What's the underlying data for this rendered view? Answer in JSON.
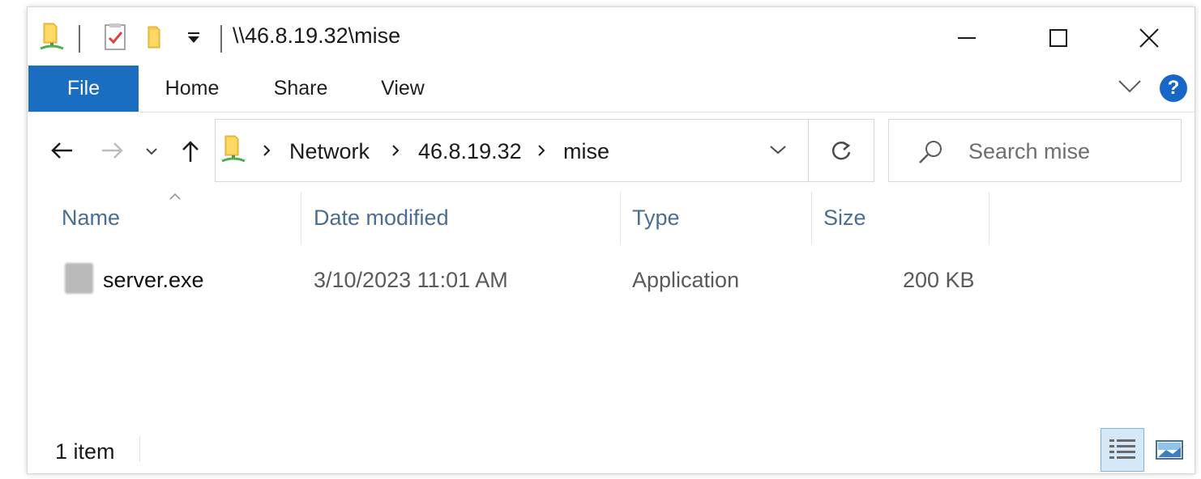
{
  "window": {
    "title": "\\\\46.8.19.32\\mise"
  },
  "ribbon": {
    "tabs": [
      {
        "label": "File"
      },
      {
        "label": "Home"
      },
      {
        "label": "Share"
      },
      {
        "label": "View"
      }
    ],
    "help_label": "?"
  },
  "address": {
    "crumbs": [
      {
        "label": "Network"
      },
      {
        "label": "46.8.19.32"
      },
      {
        "label": "mise"
      }
    ]
  },
  "search": {
    "placeholder": "Search mise"
  },
  "columns": [
    {
      "label": "Name"
    },
    {
      "label": "Date modified"
    },
    {
      "label": "Type"
    },
    {
      "label": "Size"
    }
  ],
  "files": [
    {
      "name": "server.exe",
      "date_modified": "3/10/2023 11:01 AM",
      "type": "Application",
      "size": "200 KB"
    }
  ],
  "status": {
    "item_count": "1 item"
  },
  "colors": {
    "accent": "#1a6ec2",
    "help": "#1767c8",
    "header_text": "#4a6e91"
  },
  "icons": {
    "network_folder": "network-folder-icon",
    "properties": "properties-icon",
    "new_folder": "new-folder-icon",
    "search": "search-icon",
    "refresh": "refresh-icon"
  }
}
